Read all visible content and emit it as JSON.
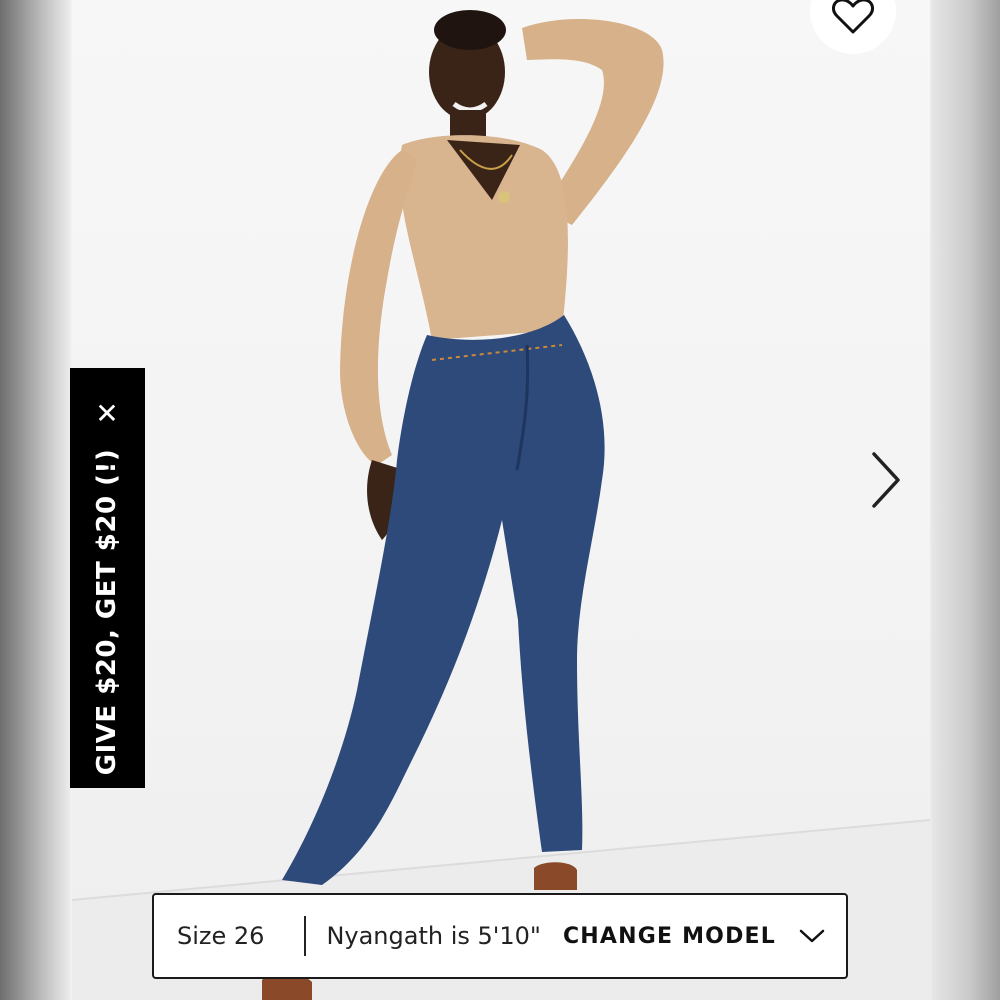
{
  "promo": {
    "text": "GIVE $20, GET $20 (!)",
    "close_icon": "close-icon",
    "close_glyph": "✕"
  },
  "wishlist": {
    "icon": "heart-icon"
  },
  "carousel": {
    "next_icon": "chevron-right-icon"
  },
  "model_bar": {
    "size_label": "Size 26",
    "model_height": "Nyangath is 5'10\"",
    "change_model_label": "CHANGE MODEL",
    "dropdown_icon": "chevron-down-icon"
  }
}
